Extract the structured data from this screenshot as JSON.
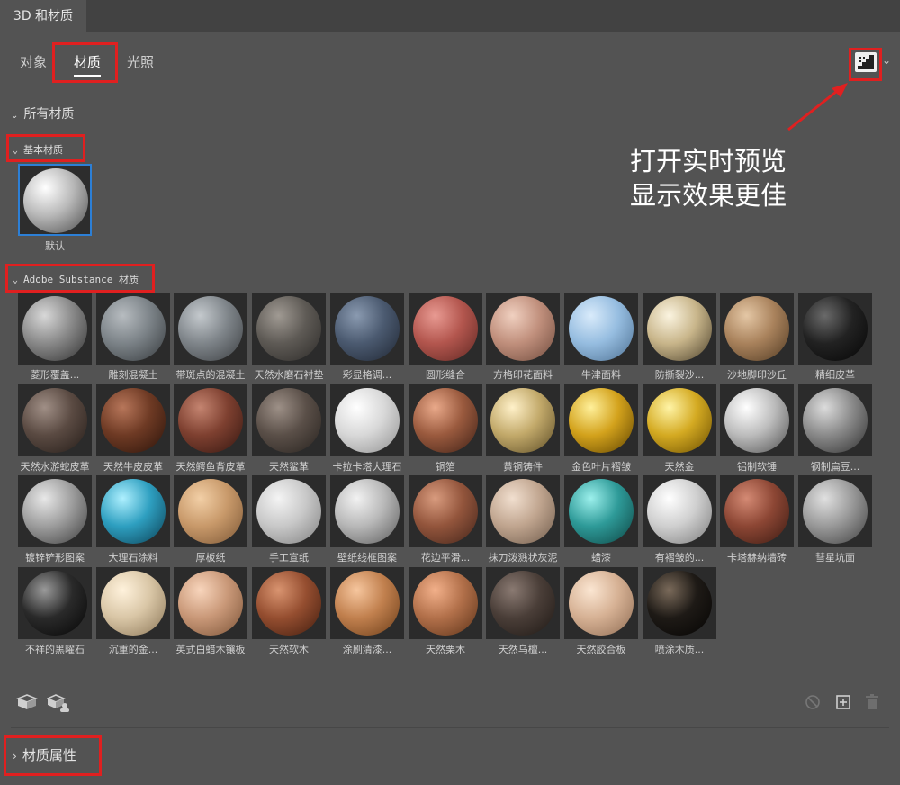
{
  "panel_title": "3D 和材质",
  "tabs": [
    {
      "label": "对象",
      "active": false
    },
    {
      "label": "材质",
      "active": true
    },
    {
      "label": "光照",
      "active": false
    }
  ],
  "preview_toggle_icon": "live-preview-icon",
  "sections": {
    "all_materials": "所有材质",
    "basic": "基本材质",
    "substance": "Adobe Substance 材质"
  },
  "annotation": {
    "line1": "打开实时预览",
    "line2": "显示效果更佳"
  },
  "basic_materials": [
    {
      "label": "默认",
      "colors": [
        "#ffffff",
        "#b8b8b8",
        "#4a4a4a"
      ],
      "selected": true
    }
  ],
  "materials": [
    {
      "label": "菱形覆盖...",
      "colors": [
        "#d8d8d8",
        "#8a8a8a",
        "#2f2f2f"
      ]
    },
    {
      "label": "雕刻混凝土",
      "colors": [
        "#b7bcc0",
        "#7c8388",
        "#35393c"
      ]
    },
    {
      "label": "带斑点的混凝土",
      "colors": [
        "#c4c9cd",
        "#7f858a",
        "#3a3d40"
      ]
    },
    {
      "label": "天然水磨石衬垫",
      "colors": [
        "#a09a93",
        "#5e5a55",
        "#2c2a28"
      ]
    },
    {
      "label": "彩显格调...",
      "colors": [
        "#8a9ab0",
        "#4b5a70",
        "#1f2632"
      ]
    },
    {
      "label": "圆形缝合",
      "colors": [
        "#e89a92",
        "#b3564e",
        "#5e2722"
      ]
    },
    {
      "label": "方格印花面料",
      "colors": [
        "#f0d0c0",
        "#c08f7c",
        "#6e4a3c"
      ]
    },
    {
      "label": "牛津面料",
      "colors": [
        "#d9ebfb",
        "#96bde0",
        "#4c6f91"
      ]
    },
    {
      "label": "防撕裂沙...",
      "colors": [
        "#fbf4e0",
        "#c8b58a",
        "#4a3f2a"
      ]
    },
    {
      "label": "沙地脚印沙丘",
      "colors": [
        "#e4c7a5",
        "#a9825c",
        "#4f3922"
      ]
    },
    {
      "label": "精细皮革",
      "colors": [
        "#6a6a6a",
        "#222222",
        "#050505"
      ]
    },
    {
      "label": "天然水游蛇皮革",
      "colors": [
        "#a08f86",
        "#5a4a42",
        "#241c18"
      ]
    },
    {
      "label": "天然牛皮皮革",
      "colors": [
        "#b7765a",
        "#6e3a24",
        "#2a130a"
      ]
    },
    {
      "label": "天然鳄鱼背皮革",
      "colors": [
        "#c48470",
        "#7e4030",
        "#331610"
      ]
    },
    {
      "label": "天然鲨革",
      "colors": [
        "#9d9087",
        "#5a4f48",
        "#27221e"
      ]
    },
    {
      "label": "卡拉卡塔大理石",
      "colors": [
        "#ffffff",
        "#d8d8d8",
        "#8f8f8f"
      ]
    },
    {
      "label": "铜箔",
      "colors": [
        "#e9a98a",
        "#9a5a3e",
        "#3e2016"
      ]
    },
    {
      "label": "黄铜铸件",
      "colors": [
        "#fff1c9",
        "#c2a96a",
        "#5a4a24"
      ]
    },
    {
      "label": "金色叶片褶皱",
      "colors": [
        "#fff09a",
        "#d3a21c",
        "#5f4300"
      ]
    },
    {
      "label": "天然金",
      "colors": [
        "#fff4a6",
        "#d4aa22",
        "#6a4d00"
      ]
    },
    {
      "label": "铝制软锤",
      "colors": [
        "#ffffff",
        "#bcbcbc",
        "#4e4e4e"
      ]
    },
    {
      "label": "钢制扁豆...",
      "colors": [
        "#dcdcdc",
        "#8a8a8a",
        "#2e2e2e"
      ]
    },
    {
      "label": "镀锌铲形图案",
      "colors": [
        "#e8e8e8",
        "#9e9e9e",
        "#3c3c3c"
      ]
    },
    {
      "label": "大理石涂料",
      "colors": [
        "#aef0ff",
        "#2e9fc0",
        "#0b3e52"
      ]
    },
    {
      "label": "厚板纸",
      "colors": [
        "#f2cfa6",
        "#c8996a",
        "#7a5534"
      ]
    },
    {
      "label": "手工宣纸",
      "colors": [
        "#f4f4f4",
        "#c8c8c8",
        "#7e7e7e"
      ]
    },
    {
      "label": "壁纸线框图案",
      "colors": [
        "#f2f2f2",
        "#b8b8b8",
        "#5a5a5a"
      ]
    },
    {
      "label": "花边平滑...",
      "colors": [
        "#d89b7e",
        "#93553c",
        "#42241a"
      ]
    },
    {
      "label": "抹刀泼溅状灰泥",
      "colors": [
        "#f1dfcf",
        "#c0a58f",
        "#6e5a4a"
      ]
    },
    {
      "label": "蜡漆",
      "colors": [
        "#9cf0ec",
        "#2e9a98",
        "#0d4442"
      ]
    },
    {
      "label": "有褶皱的...",
      "colors": [
        "#ffffff",
        "#cfcfcf",
        "#7a7a7a"
      ]
    },
    {
      "label": "卡塔赫纳墙砖",
      "colors": [
        "#d48a74",
        "#8c4634",
        "#3a1a12"
      ]
    },
    {
      "label": "彗星坑面",
      "colors": [
        "#e0e0e0",
        "#9a9a9a",
        "#3e3e3e"
      ]
    },
    {
      "label": "不祥的黑曜石",
      "colors": [
        "#9a9a9a",
        "#2a2a2a",
        "#050505"
      ]
    },
    {
      "label": "沉重的金...",
      "colors": [
        "#fff2dc",
        "#d9c6a6",
        "#8a7556"
      ]
    },
    {
      "label": "英式白蜡木镶板",
      "colors": [
        "#f8d5bc",
        "#c99878",
        "#7a5236"
      ]
    },
    {
      "label": "天然软木",
      "colors": [
        "#d99470",
        "#954e30",
        "#401c0e"
      ]
    },
    {
      "label": "涂刷清漆...",
      "colors": [
        "#f6c69e",
        "#c1804e",
        "#6a3c18"
      ]
    },
    {
      "label": "天然栗木",
      "colors": [
        "#f2b08a",
        "#b2704a",
        "#5c3218"
      ]
    },
    {
      "label": "天然乌檀...",
      "colors": [
        "#8a7a72",
        "#4a3e38",
        "#1e1814"
      ]
    },
    {
      "label": "天然胶合板",
      "colors": [
        "#fbe6d2",
        "#d6b194",
        "#8e6b52"
      ]
    },
    {
      "label": "喷涂木质...",
      "colors": [
        "#7a6a5a",
        "#1e1a16",
        "#050403"
      ]
    }
  ],
  "footer": {
    "material_properties": "材质属性"
  }
}
